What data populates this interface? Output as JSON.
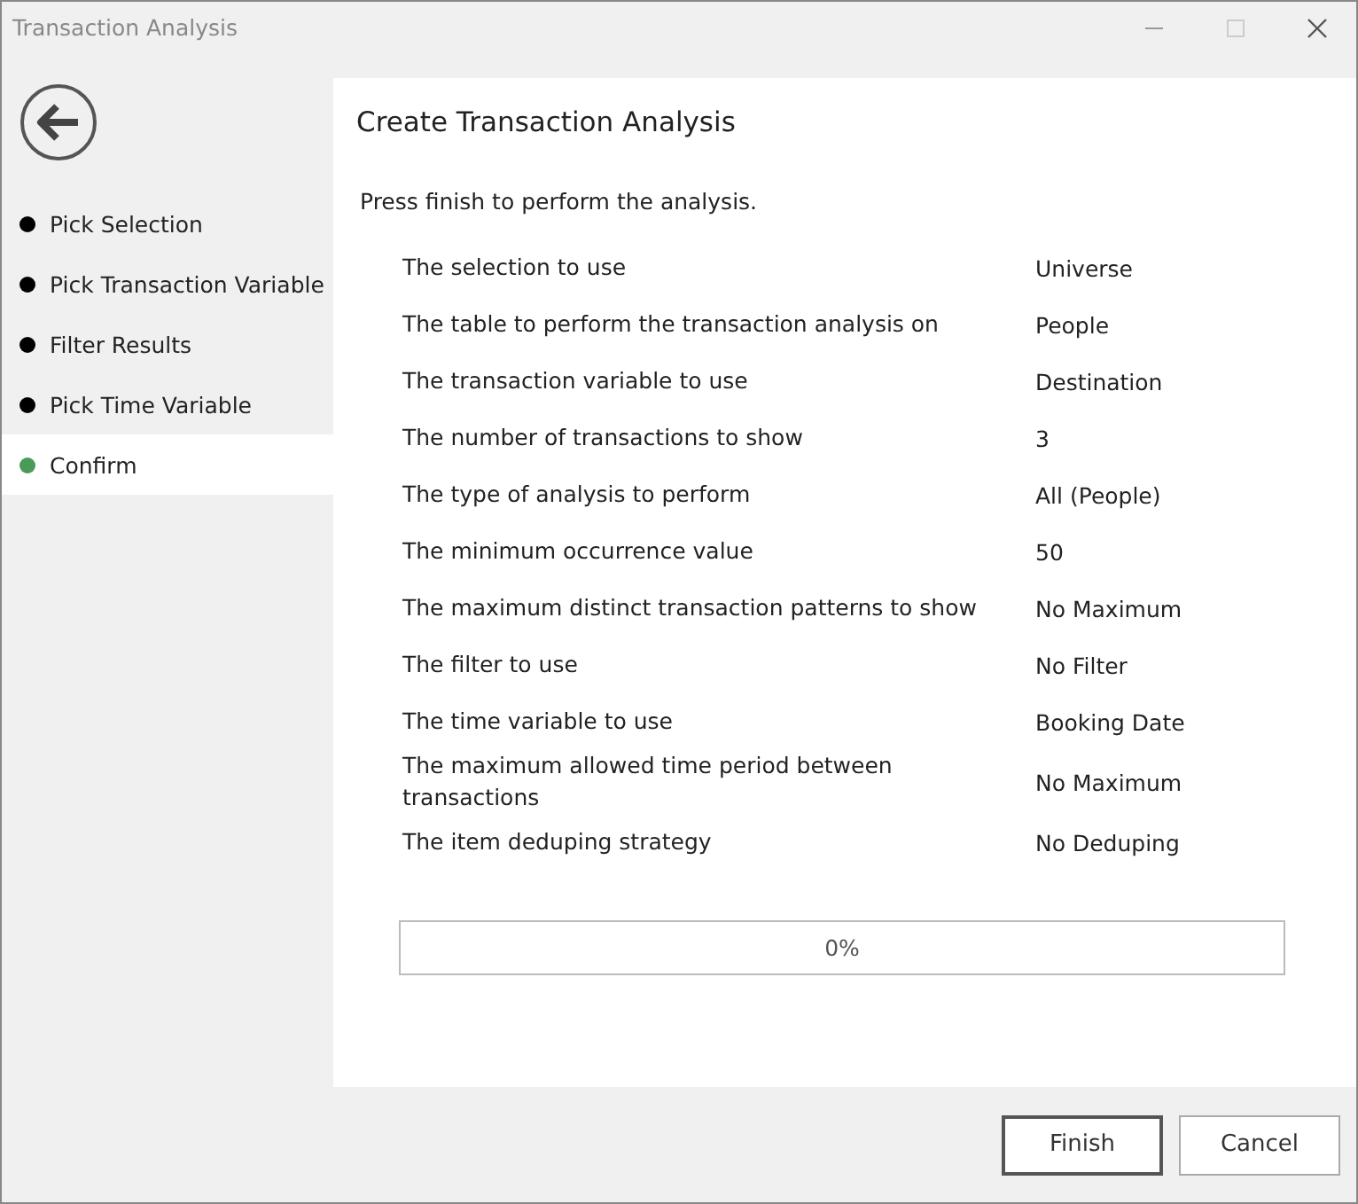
{
  "window": {
    "title": "Transaction Analysis"
  },
  "steps": [
    {
      "label": "Pick Selection",
      "selected": false
    },
    {
      "label": "Pick Transaction Variable",
      "selected": false
    },
    {
      "label": "Filter Results",
      "selected": false
    },
    {
      "label": "Pick Time Variable",
      "selected": false
    },
    {
      "label": "Confirm",
      "selected": true
    }
  ],
  "heading": "Create Transaction Analysis",
  "instruction": "Press finish to perform the analysis.",
  "summary": [
    {
      "label": "The selection to use",
      "value": "Universe"
    },
    {
      "label": "The table to perform the transaction analysis on",
      "value": "People"
    },
    {
      "label": "The transaction variable to use",
      "value": "Destination"
    },
    {
      "label": "The number of transactions to show",
      "value": "3"
    },
    {
      "label": "The type of analysis to perform",
      "value": "All (People)"
    },
    {
      "label": "The minimum occurrence value",
      "value": "50"
    },
    {
      "label": "The maximum distinct transaction patterns to show",
      "value": "No Maximum"
    },
    {
      "label": "The filter to use",
      "value": "No Filter"
    },
    {
      "label": "The time variable to use",
      "value": "Booking Date"
    },
    {
      "label": "The maximum allowed time period between transactions",
      "value": "No Maximum"
    },
    {
      "label": "The item deduping strategy",
      "value": "No Deduping"
    }
  ],
  "progress": {
    "level": 0,
    "reading": "0%"
  },
  "buttons": [
    {
      "label": "Finish",
      "kind": "default"
    },
    {
      "label": "Cancel",
      "kind": "normal"
    }
  ]
}
